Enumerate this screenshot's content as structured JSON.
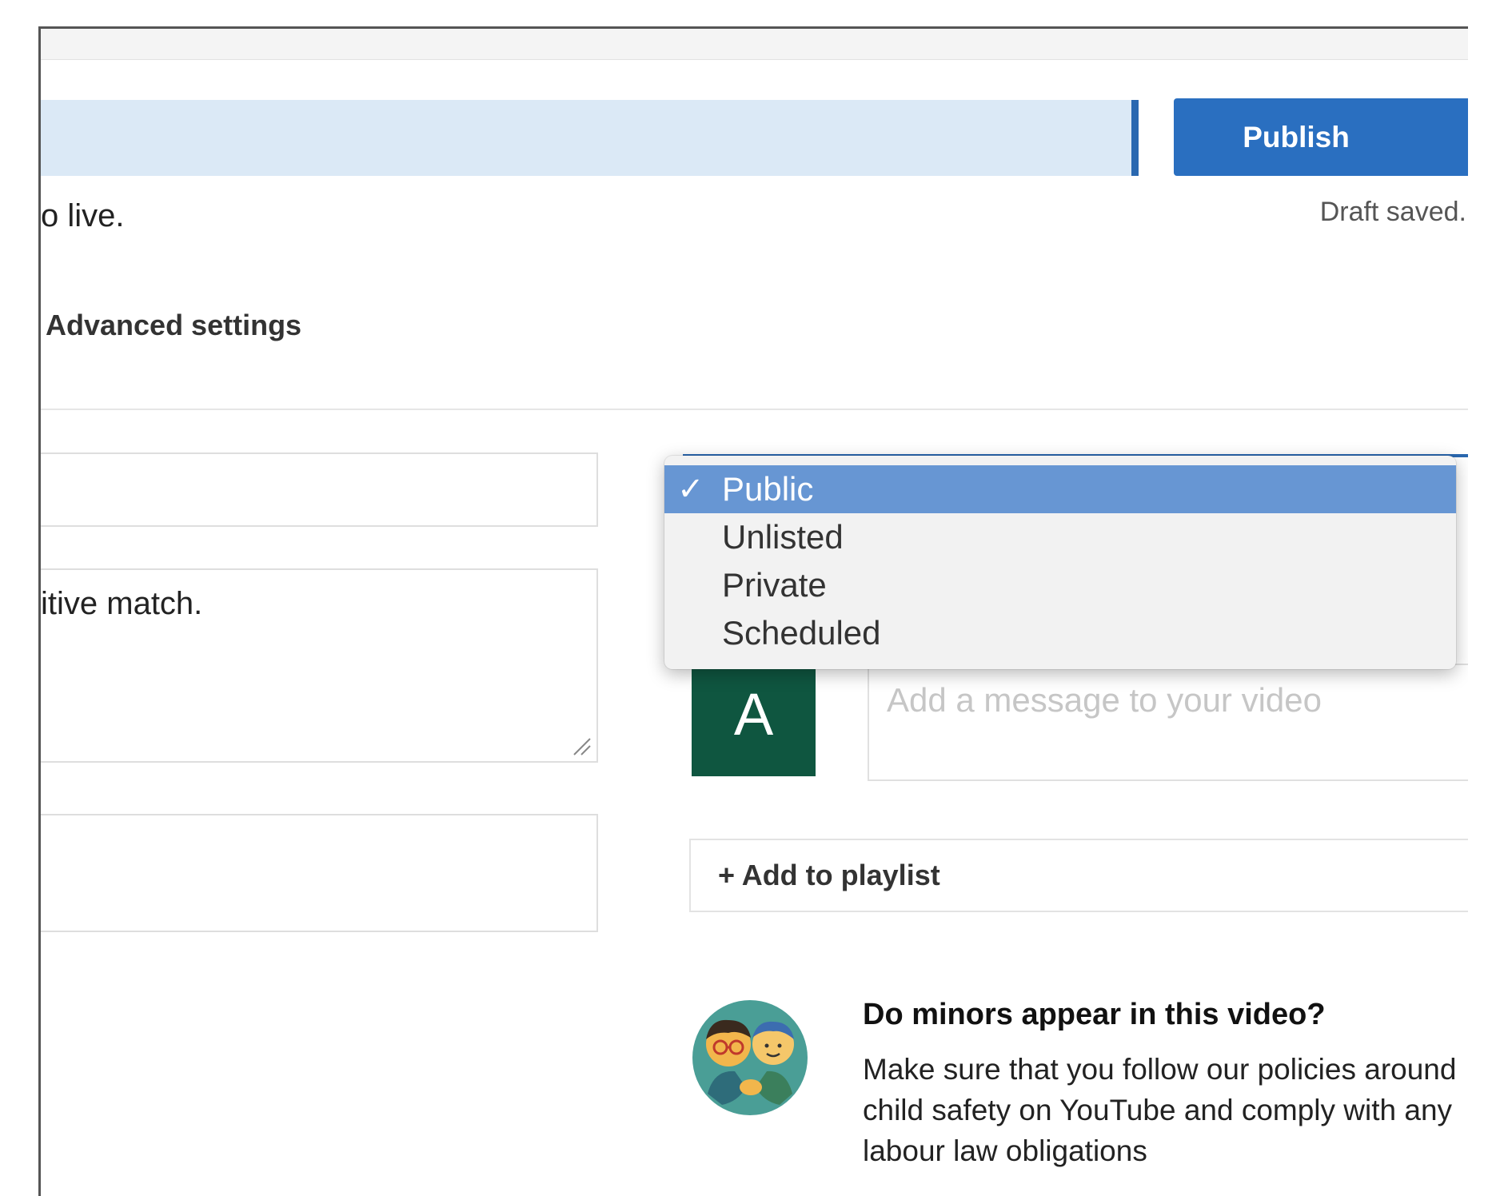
{
  "header": {
    "publish_label": "Publish",
    "draft_status": "Draft saved.",
    "status_message": "o live."
  },
  "tabs": {
    "advanced_label": "Advanced settings"
  },
  "form": {
    "description_value": "itive match.",
    "message_placeholder": "Add a message to your video",
    "avatar_letter": "A",
    "add_playlist_label": "+ Add to playlist"
  },
  "visibility": {
    "options": [
      "Public",
      "Unlisted",
      "Private",
      "Scheduled"
    ],
    "selected": "Public",
    "check_glyph": "✓"
  },
  "minors": {
    "title": "Do minors appear in this video?",
    "body": "Make sure that you follow our policies around child safety on YouTube and comply with any labour law obligations"
  },
  "colors": {
    "accent": "#2a6fc0",
    "progress_track": "#dbe9f6",
    "dropdown_selected": "#6796d3",
    "avatar_bg": "#0f5640"
  }
}
